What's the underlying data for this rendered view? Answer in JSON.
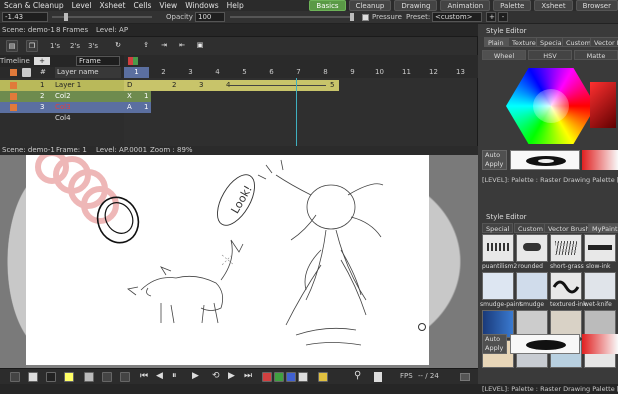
{
  "menubar": {
    "items": [
      "Scan & Cleanup",
      "Level",
      "Xsheet",
      "Cells",
      "View",
      "Windows",
      "Help"
    ]
  },
  "rooms": [
    "Basics",
    "Cleanup",
    "Drawing",
    "Animation",
    "Palette",
    "Xsheet",
    "Browser"
  ],
  "tool_options": {
    "size_value": "-1.43",
    "opacity_label": "Opacity",
    "opacity_value": "100",
    "pressure_label": "Pressure",
    "preset_label": "Preset:",
    "preset_value": "<custom>",
    "add": "+",
    "remove": "-"
  },
  "xsheet": {
    "scene_label": "Scene: demo-1",
    "frames_label": "8 Frames",
    "level_label": "Level: AP",
    "step_buttons": [
      "1's",
      "2's",
      "3's"
    ],
    "timeline_label": "Timeline",
    "frame_mode": "Frame",
    "layer_header": "Layer name",
    "hash_header": "#",
    "layers": [
      {
        "num": "1",
        "name": "Layer 1"
      },
      {
        "num": "2",
        "name": "Col2"
      },
      {
        "num": "3",
        "name": "Col3"
      },
      {
        "num": "",
        "name": "Col4"
      }
    ],
    "frames": [
      "1",
      "2",
      "3",
      "4",
      "5",
      "6",
      "7",
      "8",
      "9",
      "10",
      "11",
      "12",
      "13"
    ],
    "row1_cells": [
      "D",
      "2",
      "3",
      "4",
      "5"
    ],
    "row2_cells": [
      "X",
      "1"
    ],
    "row3_cells": [
      "A",
      "1"
    ]
  },
  "viewer": {
    "scene": "Scene: demo-1",
    "frame": "Frame: 1",
    "level": "Level: AP.0001",
    "zoom": "Zoom : 89%",
    "sketch_text": "Look!"
  },
  "playback": {
    "fps_label": "FPS",
    "fps_value": "-- / 24"
  },
  "style_editor": {
    "title": "Style Editor",
    "tabs": [
      "Plain",
      "Texture",
      "Special",
      "Custom",
      "Vector Brush"
    ],
    "sub_tabs": [
      "Wheel",
      "HSV",
      "Matte"
    ],
    "auto_apply": "Auto Apply",
    "palette_status": "[LEVEL]: Palette : Raster Drawing Palette [...]"
  },
  "brush_editor": {
    "title": "Style Editor",
    "tabs": [
      "Special",
      "Custom",
      "Vector Brush",
      "MyPaint Br"
    ],
    "brushes": [
      "puantilism2",
      "rounded",
      "short-grass",
      "slow-ink",
      "smudge-paint",
      "smudge",
      "textured-ink",
      "wet-knife"
    ],
    "auto_apply": "Auto Apply",
    "palette_status": "[LEVEL]: Palette : Raster Drawing Palette [...]"
  },
  "colors": {
    "active_room": "#5a9a46",
    "layer1": "#b9b95a",
    "layer2": "#6e8b4e",
    "layer3": "#5b6fa0",
    "col3_name": "#e04040",
    "cell_yellow": "#c8c46a"
  }
}
